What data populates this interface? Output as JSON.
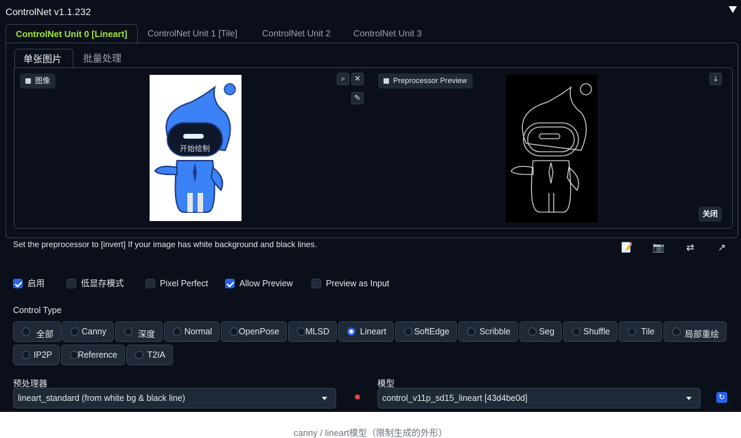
{
  "panel_title": "ControlNet v1.1.232",
  "unit_tabs": [
    "ControlNet Unit 0 [Lineart]",
    "ControlNet Unit 1 [Tile]",
    "ControlNet Unit 2",
    "ControlNet Unit 3"
  ],
  "image_tabs": [
    "单张图片",
    "批量处理"
  ],
  "input_image": {
    "label": "图像",
    "overlay_text": "开始绘制"
  },
  "preview_image": {
    "label": "Preprocessor Preview",
    "close_label": "关闭"
  },
  "hint": "Set the preprocessor to [invert] If your image has white background and black lines.",
  "checkboxes": [
    {
      "label": "启用",
      "checked": true
    },
    {
      "label": "低显存模式",
      "checked": false
    },
    {
      "label": "Pixel Perfect",
      "checked": false
    },
    {
      "label": "Allow Preview",
      "checked": true
    },
    {
      "label": "Preview as Input",
      "checked": false
    }
  ],
  "control_type": {
    "label": "Control Type",
    "options": [
      "全部",
      "Canny",
      "深度",
      "Normal",
      "OpenPose",
      "MLSD",
      "Lineart",
      "SoftEdge",
      "Scribble",
      "Seg",
      "Shuffle",
      "Tile",
      "局部重绘",
      "IP2P",
      "Reference",
      "T2IA"
    ],
    "selected": "Lineart"
  },
  "preprocessor": {
    "label": "预处理器",
    "value": "lineart_standard (from white bg & black line)"
  },
  "model": {
    "label": "模型",
    "value": "control_v11p_sd15_lineart [43d4be0d]"
  },
  "caption": "canny / lineart模型（限制生成的外形）",
  "colors": {
    "background": "#0b0f19",
    "accent_tab": "#a3e635",
    "checked": "#2563eb"
  }
}
